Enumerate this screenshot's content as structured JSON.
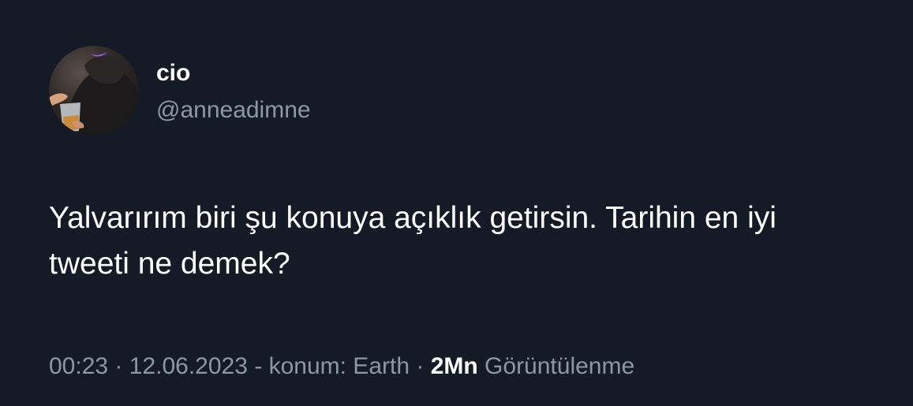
{
  "author": {
    "name": "cio",
    "handle": "@anneadimne"
  },
  "tweet": {
    "text_lines": [
      "Yalvarırım biri şu konuya açıklık getirsin. Tarihin en iyi",
      "tweeti ne demek?"
    ]
  },
  "meta": {
    "time": "00:23",
    "separator_1": "·",
    "date": "12.06.2023",
    "location_text": "- konum: Earth",
    "separator_2": "·",
    "views_count": "2Mn",
    "views_label": "Görüntülenme"
  },
  "colors": {
    "background": "#151b26",
    "primary_text": "#ffffff",
    "secondary_text": "#8b98a5"
  },
  "icons": {
    "avatar": "profile-photo-avatar"
  }
}
